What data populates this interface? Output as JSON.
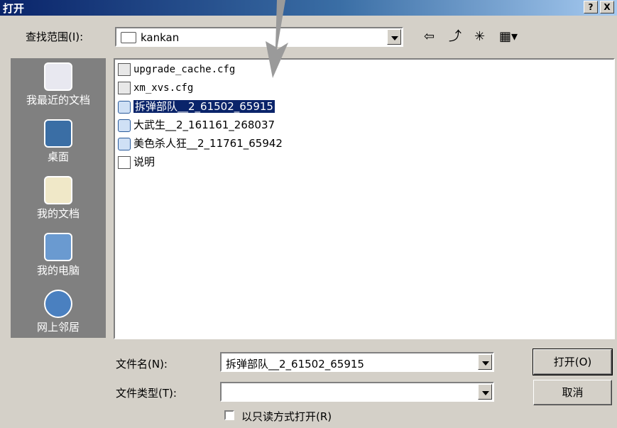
{
  "window": {
    "title": "打开",
    "help_button": "?",
    "close_button": "X"
  },
  "lookin": {
    "label": "查找范围(I):",
    "value": "kankan"
  },
  "toolbar": {
    "back": "⇦",
    "up_folder": "⤴",
    "new_folder": "✳",
    "view_menu": "▦▾"
  },
  "places": [
    {
      "label": "我最近的文档",
      "icon": "recent-documents-icon"
    },
    {
      "label": "桌面",
      "icon": "desktop-icon"
    },
    {
      "label": "我的文档",
      "icon": "my-documents-icon"
    },
    {
      "label": "我的电脑",
      "icon": "my-computer-icon"
    },
    {
      "label": "网上邻居",
      "icon": "network-places-icon"
    }
  ],
  "files": [
    {
      "name": "upgrade_cache.cfg",
      "icon": "config-file-icon"
    },
    {
      "name": "xm_xvs.cfg",
      "icon": "config-file-icon"
    },
    {
      "name": "拆弹部队__2_61502_65915",
      "icon": "video-file-icon"
    },
    {
      "name": "大武生__2_161161_268037",
      "icon": "video-file-icon"
    },
    {
      "name": "美色杀人狂__2_11761_65942",
      "icon": "video-file-icon"
    },
    {
      "name": "说明",
      "icon": "text-file-icon"
    }
  ],
  "selected_index": 2,
  "filename": {
    "label": "文件名(N):",
    "value": "拆弹部队__2_61502_65915"
  },
  "filetype": {
    "label": "文件类型(T):",
    "value": ""
  },
  "readonly": {
    "label": "以只读方式打开(R)",
    "checked": false
  },
  "buttons": {
    "open": "打开(O)",
    "cancel": "取消"
  }
}
